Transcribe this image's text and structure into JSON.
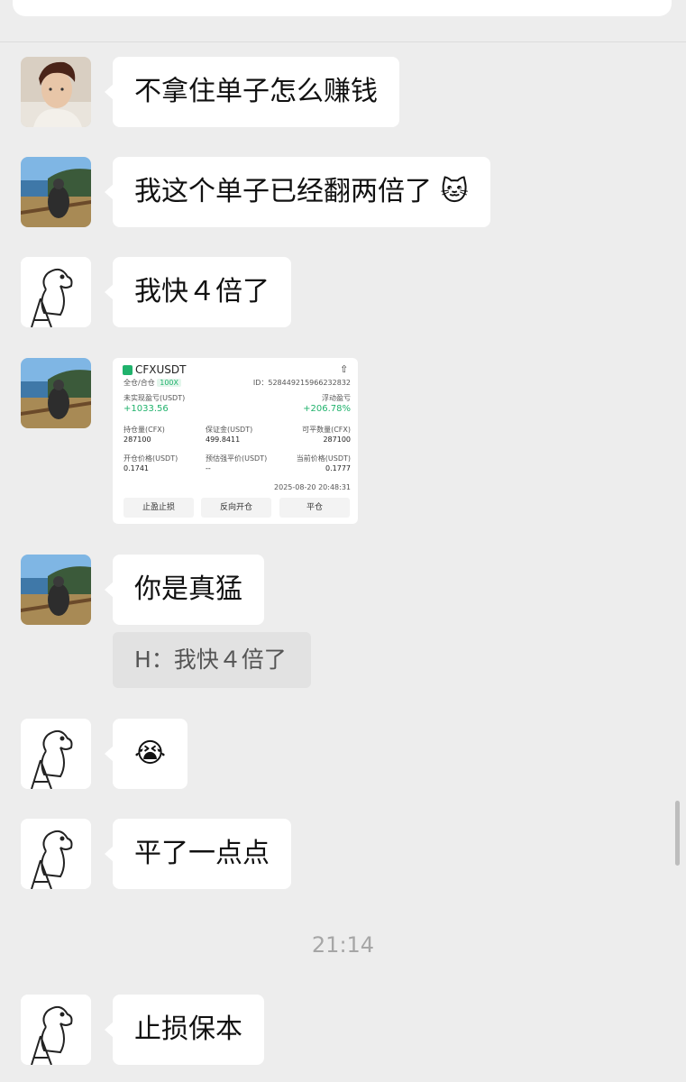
{
  "colors": {
    "background": "#ededed",
    "bubble": "#ffffff",
    "profit_green": "#20b26c"
  },
  "messages": {
    "m1": "不拿住单子怎么赚钱",
    "m2": "我这个单子已经翻两倍了",
    "m2_emoji": "🐱",
    "m3": "我快４倍了",
    "m5": "你是真猛",
    "m5_quote": "H：我快４倍了",
    "m6_emoji": "😭",
    "m7": "平了一点点",
    "m8": "止损保本"
  },
  "timestamp": "21:14",
  "card": {
    "symbol": "CFXUSDT",
    "mode": "全仓/合仓",
    "leverage": "100X",
    "id": "ID：528449215966232832",
    "unrealized_label": "未实现盈亏(USDT)",
    "unrealized_value": "+1033.56",
    "floating_label": "浮动盈亏",
    "floating_value": "+206.78%",
    "position_label": "持仓量(CFX)",
    "position_value": "287100",
    "margin_label": "保证金(USDT)",
    "margin_value": "499.8411",
    "closable_label": "可平数量(CFX)",
    "closable_value": "287100",
    "open_price_label": "开仓价格(USDT)",
    "open_price_value": "0.1741",
    "liq_label": "预估强平价(USDT)",
    "liq_value": "--",
    "current_label": "当前价格(USDT)",
    "current_value": "0.1777",
    "datetime": "2025-08-20 20:48:31",
    "btn_tp_sl": "止盈止损",
    "btn_reverse": "反向开仓",
    "btn_close": "平仓"
  }
}
